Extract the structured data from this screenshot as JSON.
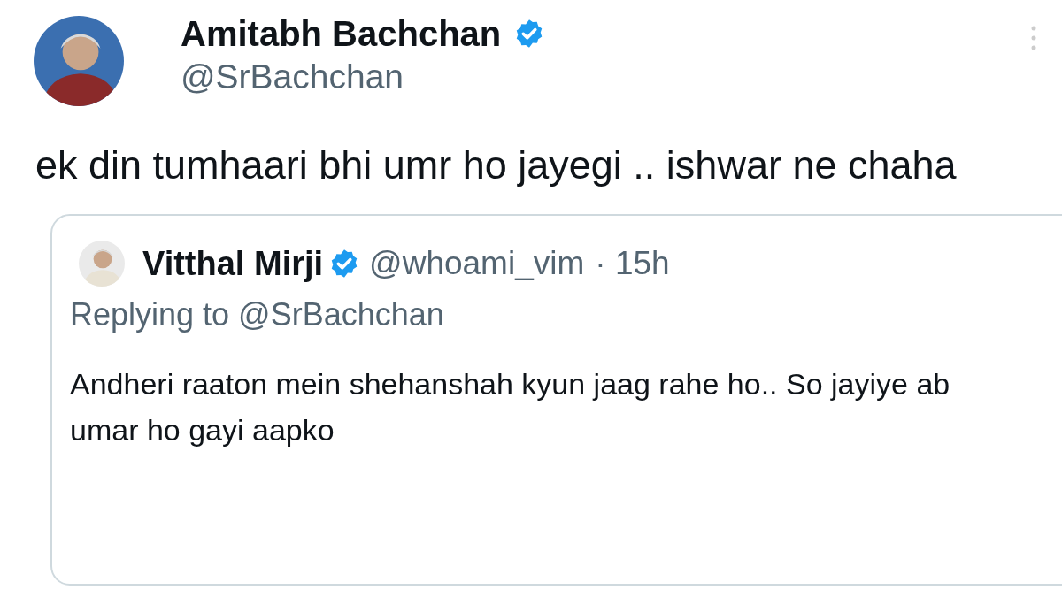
{
  "tweet": {
    "author": {
      "name": "Amitabh Bachchan",
      "verified": true,
      "handle": "@SrBachchan"
    },
    "text": "ek din tumhaari bhi umr ho jayegi .. ishwar ne chaha",
    "quoted_tweet": {
      "author": {
        "name": "Vitthal Mirji",
        "verified": true,
        "handle": "@whoami_vim"
      },
      "time": "· 15h",
      "replying_to": "Replying to @SrBachchan",
      "text": "Andheri raaton mein shehanshah kyun jaag rahe ho.. So jayiye ab umar ho gayi aapko"
    }
  }
}
